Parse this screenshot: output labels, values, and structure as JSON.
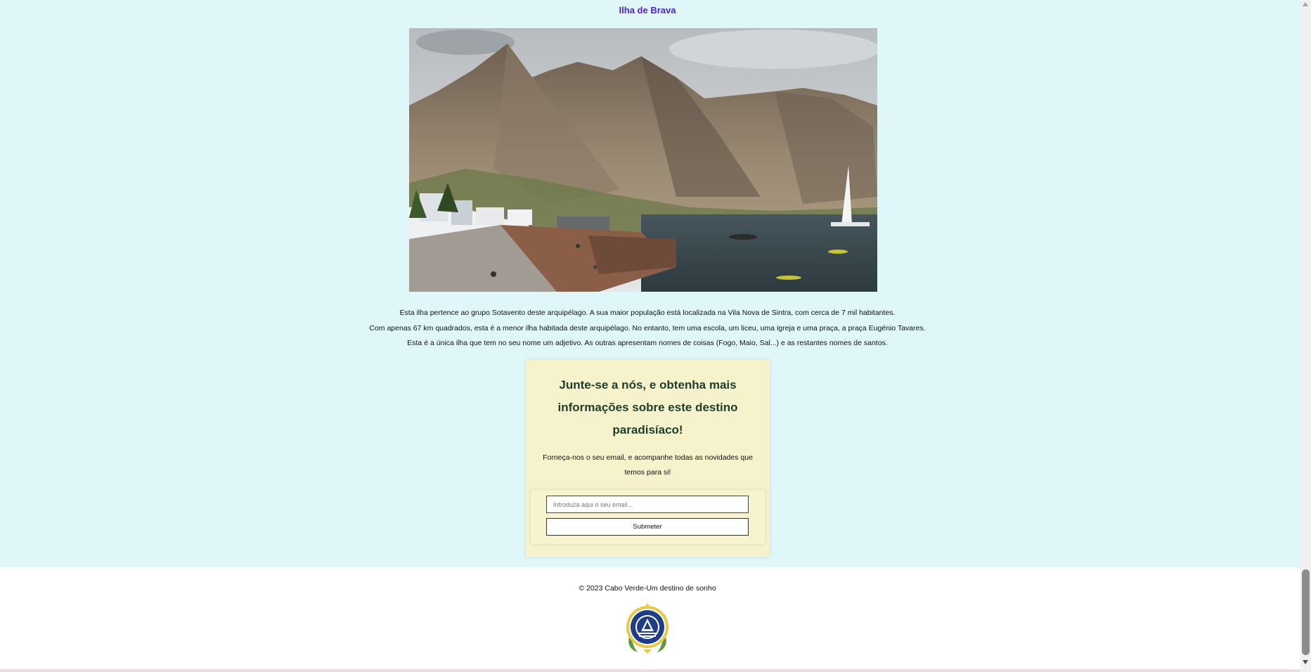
{
  "island": {
    "title": "Ilha de Brava",
    "paragraphs": [
      "Esta ilha pertence ao grupo Sotavento deste arquipélago. A sua maior população está localizada na Vila Nova de Sintra, com cerca de 7 mil habitantes.",
      "Com apenas 67 km quadrados, esta é a menor ilha habitada deste arquipélago. No entanto, tem uma escola, um liceu, uma igreja e uma praça, a praça Eugénio Tavares.",
      "Esta é a única ilha que tem no seu nome um adjetivo. As outras apresentam nomes de coisas (Fogo, Maio, Sal...) e as restantes nomes de santos."
    ]
  },
  "signup": {
    "title": "Junte-se a nós, e obtenha mais informações sobre este destino paradisíaco!",
    "text": "Forneça-nos o seu email, e acompanhe todas as novidades que temos para si!",
    "email_placeholder": "Introduza aqui o seu email...",
    "email_value": "",
    "submit_label": "Submeter"
  },
  "footer": {
    "copyright": "© 2023 Cabo Verde-Um destino de sonho"
  },
  "colors": {
    "main_background": "#e0f7fa",
    "title_color": "#4a1fd6",
    "signup_background": "#f5f2cc",
    "signup_title_color": "#1e3d2a"
  },
  "icons": {
    "emblem": "cabo-verde-coat-of-arms"
  }
}
